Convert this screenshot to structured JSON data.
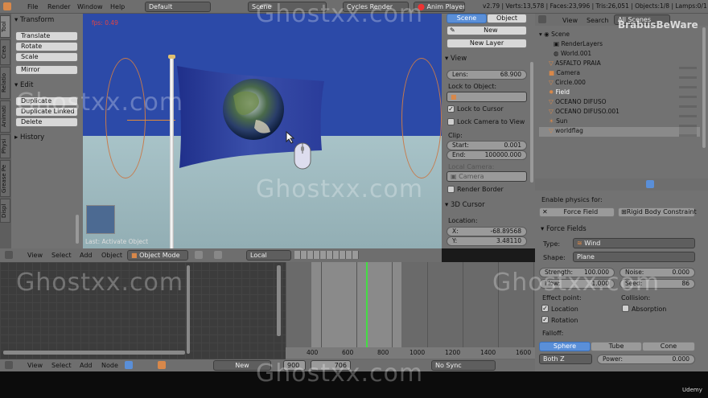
{
  "topbar": {
    "menus": [
      "File",
      "Render",
      "Window",
      "Help"
    ],
    "layout": "Default",
    "scene": "Scene",
    "engine": "Cycles Render",
    "anim_player": "Anim Player",
    "stats": "v2.79 | Verts:13,578 | Faces:23,996 | Tris:26,051 | Objects:1/8 | Lamps:0/1"
  },
  "left_tabs": [
    "Tool",
    "Crea",
    "Relatio",
    "Animati",
    "Physi",
    "Grease Pe",
    "Displ"
  ],
  "toolshelf": {
    "transform_header": "Transform",
    "translate": "Translate",
    "rotate": "Rotate",
    "scale": "Scale",
    "mirror": "Mirror",
    "edit_header": "Edit",
    "duplicate": "Duplicate",
    "duplicate_linked": "Duplicate Linked",
    "delete": "Delete",
    "history_header": "History"
  },
  "viewport": {
    "fps": "fps: 0.49",
    "last_op": "Last: Activate Object"
  },
  "view_toolbar": {
    "view": "View",
    "select": "Select",
    "add": "Add",
    "object": "Object",
    "mode": "Object Mode",
    "pivot": "Local"
  },
  "properties_n": {
    "tab_scene": "Scene",
    "tab_object": "Object",
    "new": "New",
    "new_layer": "New Layer",
    "view_header": "View",
    "lens_label": "Lens:",
    "lens": "68.900",
    "lock_object": "Lock to Object:",
    "lock_cursor": "Lock to Cursor",
    "lock_camera": "Lock Camera to View",
    "clip": "Clip:",
    "start_label": "Start:",
    "start": "0.001",
    "end_label": "End:",
    "end": "100000.000",
    "local_camera": "Local Camera:",
    "camera": "Camera",
    "render_border": "Render Border",
    "cursor_header": "3D Cursor",
    "location": "Location:",
    "x_label": "X:",
    "x": "-68.89568",
    "y_label": "Y:",
    "y": "3.48110"
  },
  "outliner": {
    "view": "View",
    "search": "Search",
    "scenes": "All Scenes",
    "items": [
      {
        "name": "Scene"
      },
      {
        "name": "RenderLayers"
      },
      {
        "name": "World.001"
      },
      {
        "name": "ASFALTO PRAIA"
      },
      {
        "name": "Camera"
      },
      {
        "name": "Circle.000"
      },
      {
        "name": "Field"
      },
      {
        "name": "OCEANO DIFUSO"
      },
      {
        "name": "OCEANO DIFUSO.001"
      },
      {
        "name": "Sun"
      },
      {
        "name": "worldflag"
      }
    ]
  },
  "physics": {
    "enable": "Enable physics for:",
    "force_field": "Force Field",
    "rigid_body": "Rigid Body Constraint",
    "force_fields_header": "Force Fields",
    "type_label": "Type:",
    "type": "Wind",
    "shape_label": "Shape:",
    "shape": "Plane",
    "strength_label": "Strength:",
    "strength": "100.000",
    "noise_label": "Noise:",
    "noise": "0.000",
    "flow_label": "Flow:",
    "flow": "1.000",
    "seed_label": "Seed:",
    "seed": "86",
    "effect_point": "Effect point:",
    "collision": "Collision:",
    "location": "Location",
    "absorption": "Absorption",
    "rotation": "Rotation",
    "falloff": "Falloff:",
    "sphere": "Sphere",
    "tube": "Tube",
    "cone": "Cone",
    "both_z": "Both Z",
    "power_label": "Power:",
    "power": "0.000"
  },
  "timeline": {
    "ticks": [
      "400",
      "600",
      "800",
      "1000",
      "1200",
      "1400",
      "1600"
    ],
    "start": "900",
    "current": "706",
    "sync": "No Sync"
  },
  "node_toolbar": {
    "view": "View",
    "select": "Select",
    "add": "Add",
    "node": "Node",
    "new": "New"
  },
  "watermarks": [
    "Ghostxx.com",
    "Ghostxx.com",
    "Ghostxx.com",
    "Ghostxx.com",
    "Ghostxx.com",
    "Ghostxx.com"
  ],
  "brand": "BrabusBeWare",
  "udemy": "Udemy",
  "colors": {
    "sky": "#2c4aa8",
    "ground": "#9fb9be",
    "accent": "#5a8fd8",
    "panel": "#727272"
  }
}
